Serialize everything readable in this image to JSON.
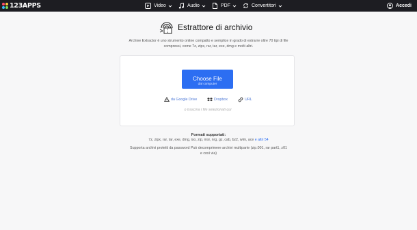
{
  "header": {
    "logo_text": "123APPS",
    "nav": [
      {
        "label": "Video",
        "icon": "play-icon"
      },
      {
        "label": "Audio",
        "icon": "music-note-icon"
      },
      {
        "label": "PDF",
        "icon": "pdf-icon"
      },
      {
        "label": "Convertitori",
        "icon": "convert-icon"
      }
    ],
    "login_label": "Accedi"
  },
  "main": {
    "title": "Estrattore di archivio",
    "description": "Archive Extractor è uno strumento online compatto e semplice in grado di estrarre oltre 70 tipi di file compressi, come 7z, zipx, rar, tar, exe, dmg e molti altri.",
    "choose_button": {
      "label": "Choose File",
      "sublabel": "dal computer"
    },
    "sources": [
      {
        "label": "da Google Drive",
        "icon": "google-drive-icon"
      },
      {
        "label": "Dropbox",
        "icon": "dropbox-icon"
      },
      {
        "label": "URL",
        "icon": "link-icon"
      }
    ],
    "drop_hint": "o trascina i file selezionati qui",
    "formats_title": "Formati supportati:",
    "formats_list": "7z, zipx, rar, tar, exe, dmg, iso, zip, msi, nrg, gz, cab, bz2, wim, ace",
    "formats_more": "e altri 54",
    "support_text": "Supporta archivi protetti da password Può decomprimere archivi multiparte (zip.001, rar part1, z01 e così via)"
  },
  "colors": {
    "topbar": "#1d1d22",
    "accent": "#2c6ef2",
    "link": "#4a76d6",
    "background": "#f7f7f8"
  }
}
